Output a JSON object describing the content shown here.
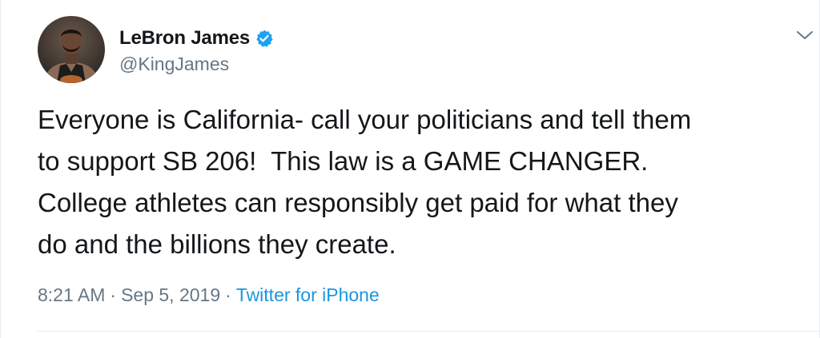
{
  "tweet": {
    "author": {
      "display_name": "LeBron James",
      "handle": "@KingJames",
      "verified": true,
      "verified_icon": "verified-badge-icon",
      "avatar_icon": "profile-avatar"
    },
    "text": "Everyone is California- call your politicians and tell them\nto support SB 206!  This law is a GAME CHANGER.\nCollege athletes can responsibly get paid for what they\ndo and the billions they create.",
    "time": "8:21 AM",
    "separator": "·",
    "date": "Sep 5, 2019",
    "source": "Twitter for iPhone",
    "menu_icon": "chevron-down-icon"
  },
  "colors": {
    "text": "#14171a",
    "secondary": "#657786",
    "link": "#1b95e0",
    "verified": "#1da1f2",
    "divider": "#e6ecf0"
  }
}
